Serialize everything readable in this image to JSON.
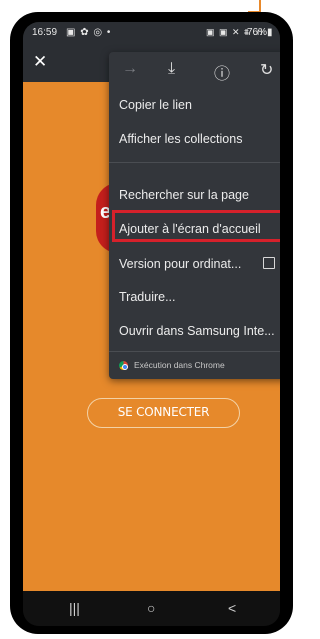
{
  "status_bar": {
    "time": "16:59",
    "left_icons": "▣ ✿ ◎ •",
    "right_icons": "▣ ▣ ✕ ⩩ .ıl",
    "battery": "76%▮"
  },
  "toolbar": {
    "close_label": "✕"
  },
  "menu": {
    "top_icons": [
      "→",
      "⤓",
      "ⓘ",
      "↻"
    ],
    "items": [
      {
        "label": "Copier le lien"
      },
      {
        "label": "Afficher les collections"
      },
      {
        "label": "Rechercher sur la page"
      },
      {
        "label": "Ajouter à l'écran d'accueil"
      },
      {
        "label": "Version pour ordinat..."
      },
      {
        "label": "Traduire..."
      },
      {
        "label": "Ouvrir dans Samsung Inte..."
      }
    ],
    "footer": "Exécution dans Chrome"
  },
  "page": {
    "logo_letter": "e",
    "connect_button": "SE CONNECTER"
  },
  "nav": {
    "recents": "|||",
    "home": "○",
    "back": "<"
  },
  "colors": {
    "page_background": "#e6892b",
    "menu_background": "#33363b",
    "highlight": "#d6212b",
    "logo_red": "#c41f1c"
  }
}
